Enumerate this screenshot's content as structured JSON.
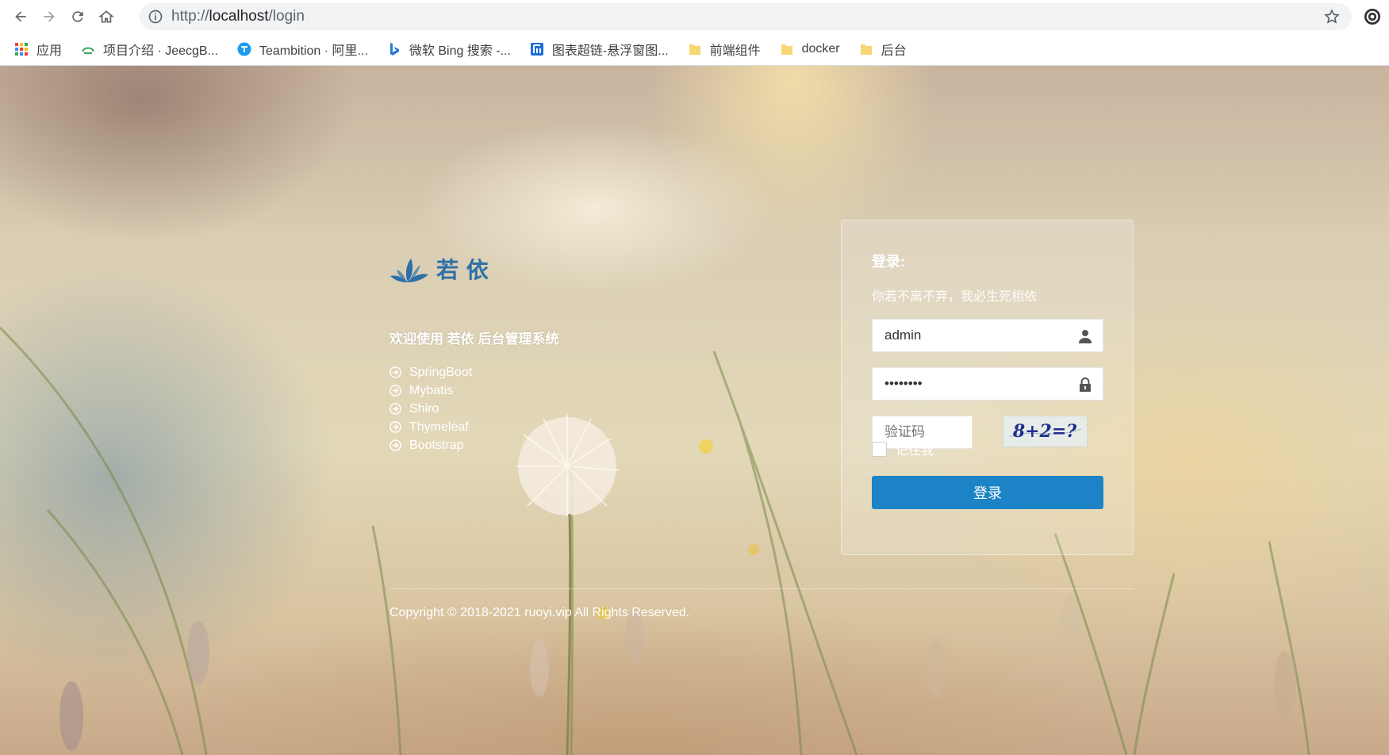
{
  "browser": {
    "url_scheme": "http://",
    "url_host": "localhost",
    "url_path": "/login",
    "bookmarks": [
      {
        "label": "应用",
        "icon": "apps-grid-icon"
      },
      {
        "label": "项目介绍 · JeecgB...",
        "icon": "jeecg-icon"
      },
      {
        "label": "Teambition · 阿里...",
        "icon": "teambition-icon"
      },
      {
        "label": "微软 Bing 搜索 -...",
        "icon": "bing-icon"
      },
      {
        "label": "图表超链-悬浮窗图...",
        "icon": "chart-app-icon"
      },
      {
        "label": "前端组件",
        "icon": "folder-icon"
      },
      {
        "label": "docker",
        "icon": "folder-icon"
      },
      {
        "label": "后台",
        "icon": "folder-icon"
      }
    ]
  },
  "brand": {
    "logo_text": "若 依",
    "welcome": "欢迎使用 若依 后台管理系统",
    "features": [
      "SpringBoot",
      "Mybatis",
      "Shiro",
      "Thymeleaf",
      "Bootstrap"
    ],
    "copyright": "Copyright © 2018-2021 ruoyi.vip All Rights Reserved."
  },
  "login": {
    "title": "登录:",
    "subtitle": "你若不离不弃，我必生死相依",
    "username_value": "admin",
    "password_value": "admin123",
    "captcha_placeholder": "验证码",
    "captcha_text": "8+2=?",
    "remember_label": "记住我",
    "submit_label": "登录"
  },
  "colors": {
    "primary": "#1c84c6",
    "logo_blue": "#2d6fa8"
  }
}
